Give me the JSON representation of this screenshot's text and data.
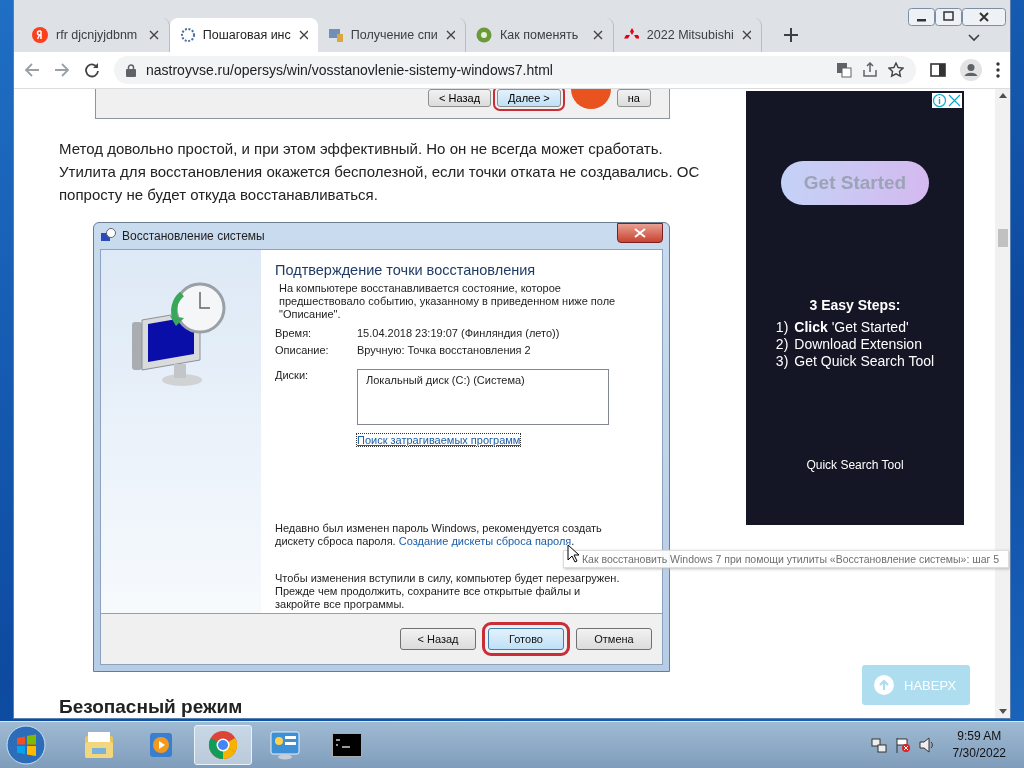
{
  "browser": {
    "tabs": [
      {
        "title": "rfr djcnjyjdbnm",
        "kind": "yandex",
        "selected": false
      },
      {
        "title": "Пошаговая инс",
        "kind": "gear",
        "selected": true
      },
      {
        "title": "Получение спи",
        "kind": "computer",
        "selected": false
      },
      {
        "title": "Как поменять",
        "kind": "green",
        "selected": false
      },
      {
        "title": "2022 Mitsubishi",
        "kind": "mitsubishi",
        "selected": false
      }
    ],
    "address": "nastroyvse.ru/opersys/win/vosstanovlenie-sistemy-windows7.html"
  },
  "article": {
    "prev_screenshot": {
      "buttons": [
        {
          "label": "< Назад",
          "highlighted": false
        },
        {
          "label": "Далее >",
          "highlighted": true
        },
        {
          "label": "на",
          "highlighted": false
        }
      ]
    },
    "paragraph": "Метод довольно простой, и при этом эффективный. Но он не всегда может сработать. Утилита для восстановления окажется бесполезной, если точки отката не создавались. ОС попросту не будет откуда восстанавливаться.",
    "dialog": {
      "title": "Восстановление системы",
      "heading": "Подтверждение точки восстановления",
      "intro": "На компьютере восстанавливается состояние, которое предшествовало событию, указанному в приведенном ниже поле \"Описание\".",
      "fields": [
        {
          "label": "Время:",
          "value": "15.04.2018 23:19:07 (Финляндия (лето))"
        },
        {
          "label": "Описание:",
          "value": "Вручную: Точка восстановления 2"
        }
      ],
      "disks_label": "Диски:",
      "disks": [
        "Локальный диск (C:) (Система)"
      ],
      "programs_link": "Поиск затрагиваемых программ",
      "password_note": "Недавно был изменен пароль Windows, рекомендуется создать дискету сброса пароля.",
      "password_link": "Создание дискеты сброса пароля",
      "password_tail": ".",
      "restart_note": "Чтобы изменения вступили в силу, компьютер будет перезагружен. Прежде чем продолжить, сохраните все открытые файлы и закройте все программы.",
      "buttons": [
        {
          "label": "< Назад",
          "highlighted": false
        },
        {
          "label": "Готово",
          "highlighted": true
        },
        {
          "label": "Отмена",
          "highlighted": false
        }
      ]
    },
    "tooltip": "Как восстановить Windows 7 при помощи утилиты «Восстановление системы»: шаг 5",
    "next_heading": "Безопасный режим"
  },
  "ad": {
    "button": "Get Started",
    "steps_title": "3 Easy Steps:",
    "steps": [
      {
        "number": "1)",
        "text": "**Click** 'Get Started'"
      },
      {
        "number": "2)",
        "text": "Download Extension"
      },
      {
        "number": "3)",
        "text": "Get Quick Search Tool"
      }
    ],
    "footer": "Quick Search Tool"
  },
  "back_to_top": "НАВЕРХ",
  "taskbar": {
    "apps": [
      {
        "kind": "explorer",
        "active": false
      },
      {
        "kind": "media",
        "active": false
      },
      {
        "kind": "chrome",
        "active": true
      },
      {
        "kind": "panel",
        "active": false
      },
      {
        "kind": "cmd",
        "active": false
      }
    ],
    "time": "9:59 AM",
    "date": "7/30/2022"
  }
}
